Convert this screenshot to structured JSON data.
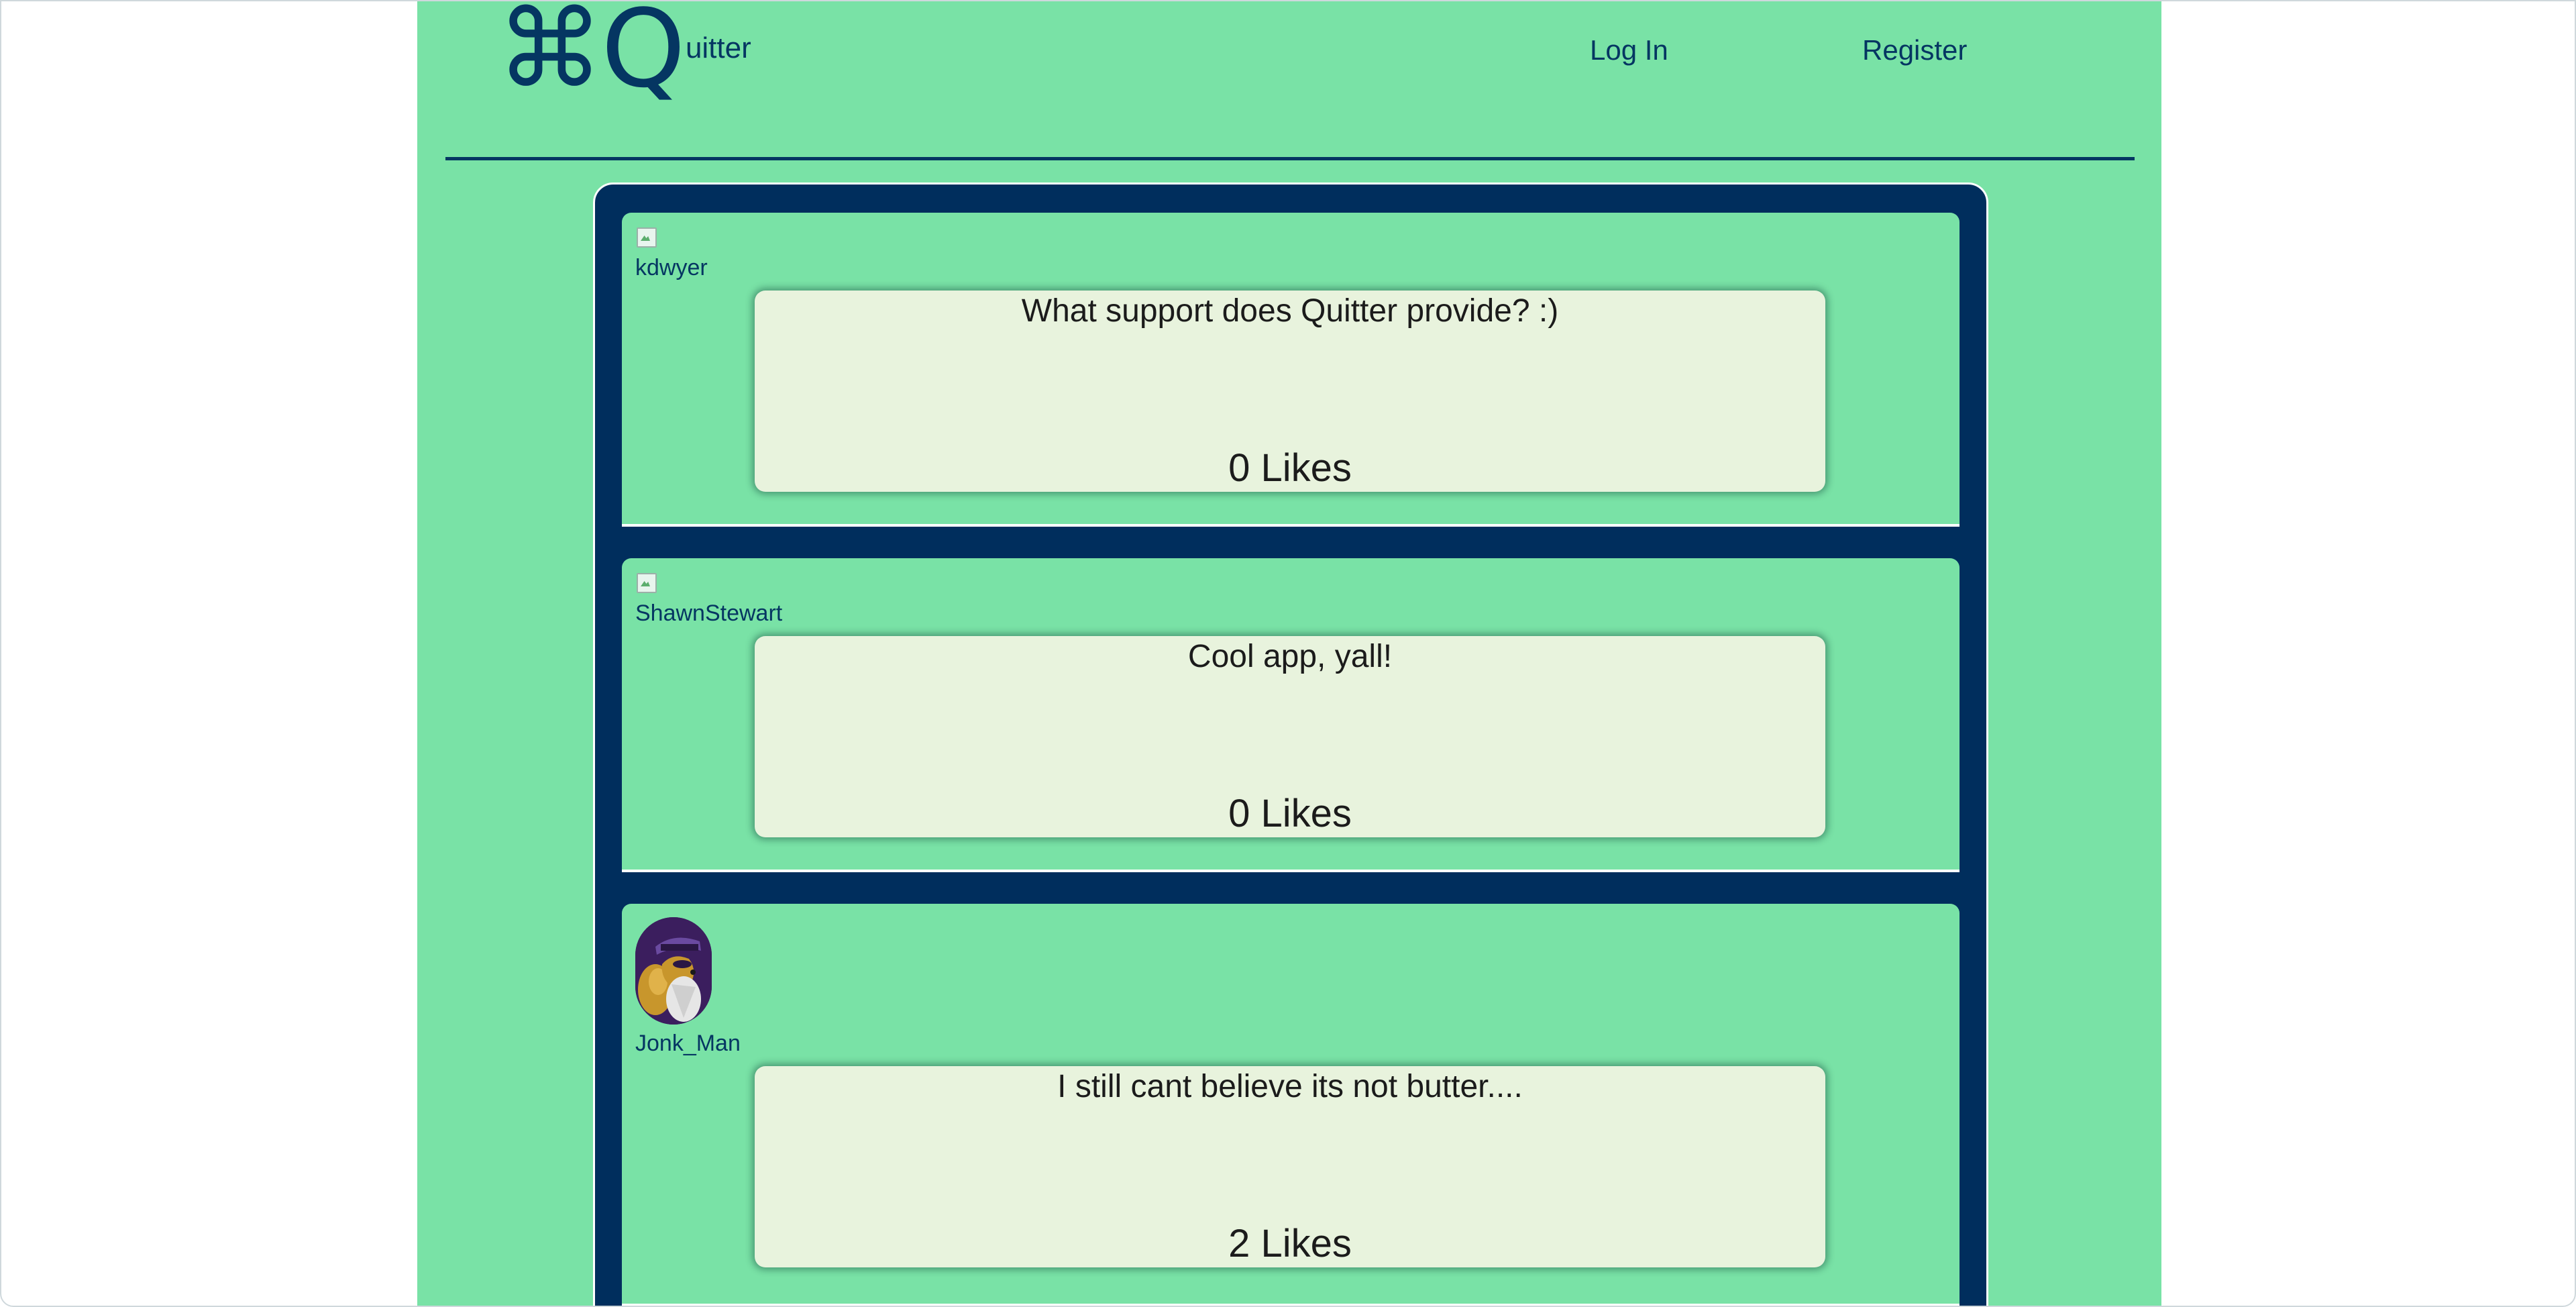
{
  "header": {
    "logo_mark": "⌘Q",
    "logo_rest": "uitter",
    "nav": {
      "login": "Log In",
      "register": "Register"
    }
  },
  "colors": {
    "page_bg": "#79e2a6",
    "feed_bg": "#002e5d",
    "accent_text": "#053662",
    "bubble_bg": "#e8f3dd"
  },
  "posts": [
    {
      "username": "kdwyer",
      "avatar": "broken-image-icon",
      "text": "What support does Quitter provide? :)",
      "likes": "0 Likes"
    },
    {
      "username": "ShawnStewart",
      "avatar": "broken-image-icon",
      "text": "Cool app, yall!",
      "likes": "0 Likes"
    },
    {
      "username": "Jonk_Man",
      "avatar": "cartoon-squirrel-detective-avatar",
      "text": "I still cant believe its not butter....",
      "likes": "2 Likes"
    }
  ]
}
